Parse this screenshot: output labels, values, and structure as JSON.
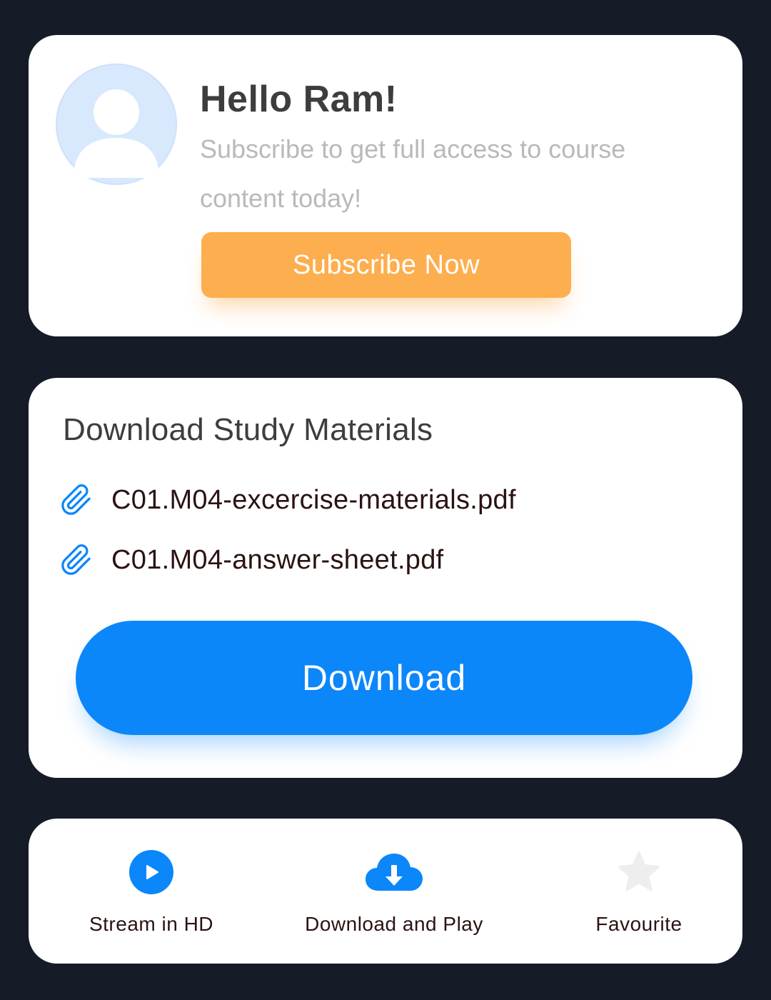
{
  "greeting": {
    "title": "Hello Ram!",
    "subtitle": "Subscribe to get full access to course content today!",
    "subscribe_label": "Subscribe Now",
    "avatar_icon": "user-avatar-icon"
  },
  "study_materials": {
    "title": "Download Study Materials",
    "files": [
      {
        "name": "C01.M04-excercise-materials.pdf",
        "icon": "paperclip-icon"
      },
      {
        "name": "C01.M04-answer-sheet.pdf",
        "icon": "paperclip-icon"
      }
    ],
    "download_label": "Download"
  },
  "actions": [
    {
      "label": "Stream in HD",
      "icon": "play-circle-icon"
    },
    {
      "label": "Download and Play",
      "icon": "cloud-download-icon"
    },
    {
      "label": "Favourite",
      "icon": "star-icon"
    }
  ],
  "colors": {
    "background": "#151b27",
    "card": "#ffffff",
    "accent_orange": "#fdae4e",
    "accent_blue": "#0b87fa",
    "avatar_bg": "#d8e8fd",
    "star_inactive": "#eeeeee"
  }
}
